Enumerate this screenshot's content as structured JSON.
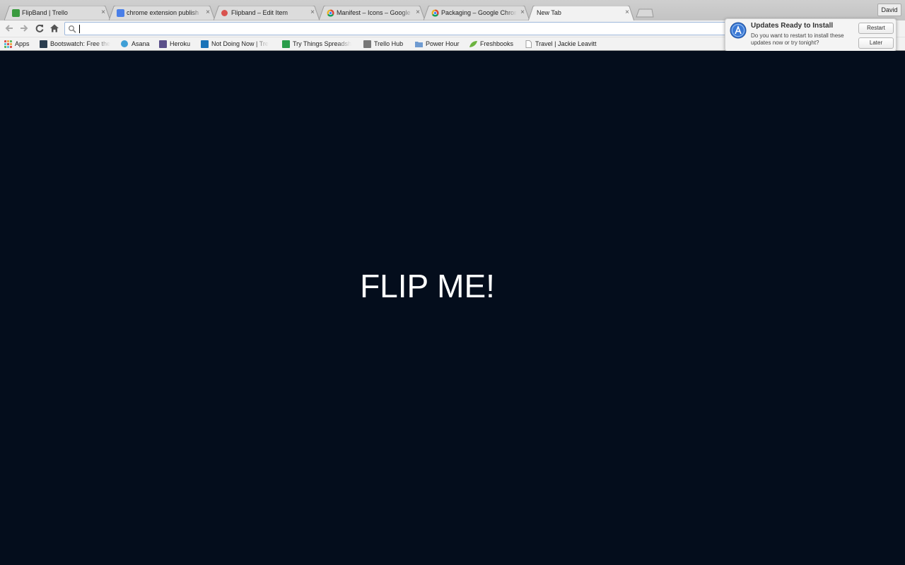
{
  "browser": {
    "tabs": [
      {
        "title": "FlipBand | Trello",
        "favicon": "trello-icon",
        "color": "#3a9b3f"
      },
      {
        "title": "chrome extension publish",
        "favicon": "google-icon",
        "color": "#4a7fe8"
      },
      {
        "title": "Flipband – Edit Item",
        "favicon": "store-icon",
        "color": "#d9534f"
      },
      {
        "title": "Manifest – Icons – Google",
        "favicon": "chrome-icon",
        "color": "#e8b22a"
      },
      {
        "title": "Packaging – Google Chrom",
        "favicon": "chrome-icon",
        "color": "#e8b22a"
      },
      {
        "title": "New Tab",
        "favicon": "",
        "color": ""
      }
    ],
    "profile_name": "David",
    "omnibox": {
      "value": "",
      "placeholder": ""
    },
    "bookmarks": [
      {
        "label": "Apps",
        "icon": "apps-grid-icon",
        "color": "#d9534f"
      },
      {
        "label": "Bootswatch: Free the",
        "icon": "bootswatch-icon",
        "color": "#2b3e50"
      },
      {
        "label": "Asana",
        "icon": "asana-icon",
        "color": "#3f9fd6"
      },
      {
        "label": "Heroku",
        "icon": "heroku-icon",
        "color": "#5a4f8a"
      },
      {
        "label": "Not Doing Now | Tre",
        "icon": "trello-icon",
        "color": "#1a73b8"
      },
      {
        "label": "Try Things Spreadsh",
        "icon": "sheets-icon",
        "color": "#2a9d4b"
      },
      {
        "label": "Trello Hub",
        "icon": "trello-icon",
        "color": "#777777"
      },
      {
        "label": "Power Hour",
        "icon": "folder-icon",
        "color": "#6f9bd1"
      },
      {
        "label": "Freshbooks",
        "icon": "leaf-icon",
        "color": "#6cb33f"
      },
      {
        "label": "Travel | Jackie Leavitt",
        "icon": "page-icon",
        "color": "#ffffff"
      }
    ]
  },
  "notification": {
    "title": "Updates Ready to Install",
    "body": "Do you want to restart to install these updates now or try tonight?",
    "restart_label": "Restart",
    "later_label": "Later",
    "icon": "app-store-icon"
  },
  "page": {
    "headline": "FLIP ME!",
    "background": "#040d1c"
  }
}
